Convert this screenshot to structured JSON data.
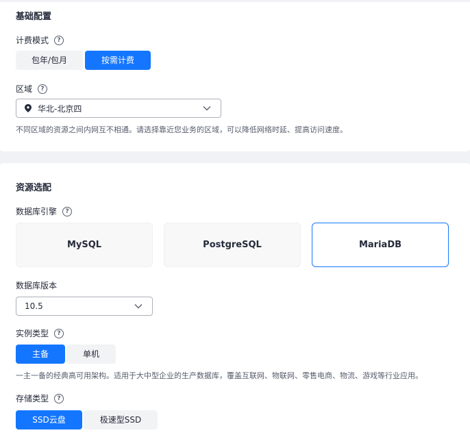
{
  "basic": {
    "title": "基础配置",
    "billing": {
      "label": "计费模式",
      "options": [
        "包年/包月",
        "按需计费"
      ],
      "selected": "按需计费"
    },
    "region": {
      "label": "区域",
      "value": "华北-北京四",
      "hint": "不同区域的资源之间内网互不相通。请选择靠近您业务的区域，可以降低网络时延、提高访问速度。"
    }
  },
  "resource": {
    "title": "资源选配",
    "engine": {
      "label": "数据库引擎",
      "options": [
        "MySQL",
        "PostgreSQL",
        "MariaDB"
      ],
      "selected": "MariaDB"
    },
    "version": {
      "label": "数据库版本",
      "value": "10.5"
    },
    "instance_type": {
      "label": "实例类型",
      "options": [
        "主备",
        "单机"
      ],
      "selected": "主备",
      "hint": "一主一备的经典高可用架构。适用于大中型企业的生产数据库，覆盖互联网、物联网、零售电商、物流、游戏等行业应用。"
    },
    "storage_type": {
      "label": "存储类型",
      "options": [
        "SSD云盘",
        "极速型SSD"
      ],
      "selected": "SSD云盘"
    }
  },
  "icons": {
    "help": "?",
    "location": "location-pin-icon",
    "dropdown": "chevron-down-icon"
  },
  "colors": {
    "accent": "#1476ff",
    "text": "#252b3a",
    "hint": "#575d6c",
    "background": "#f0f2f5"
  }
}
